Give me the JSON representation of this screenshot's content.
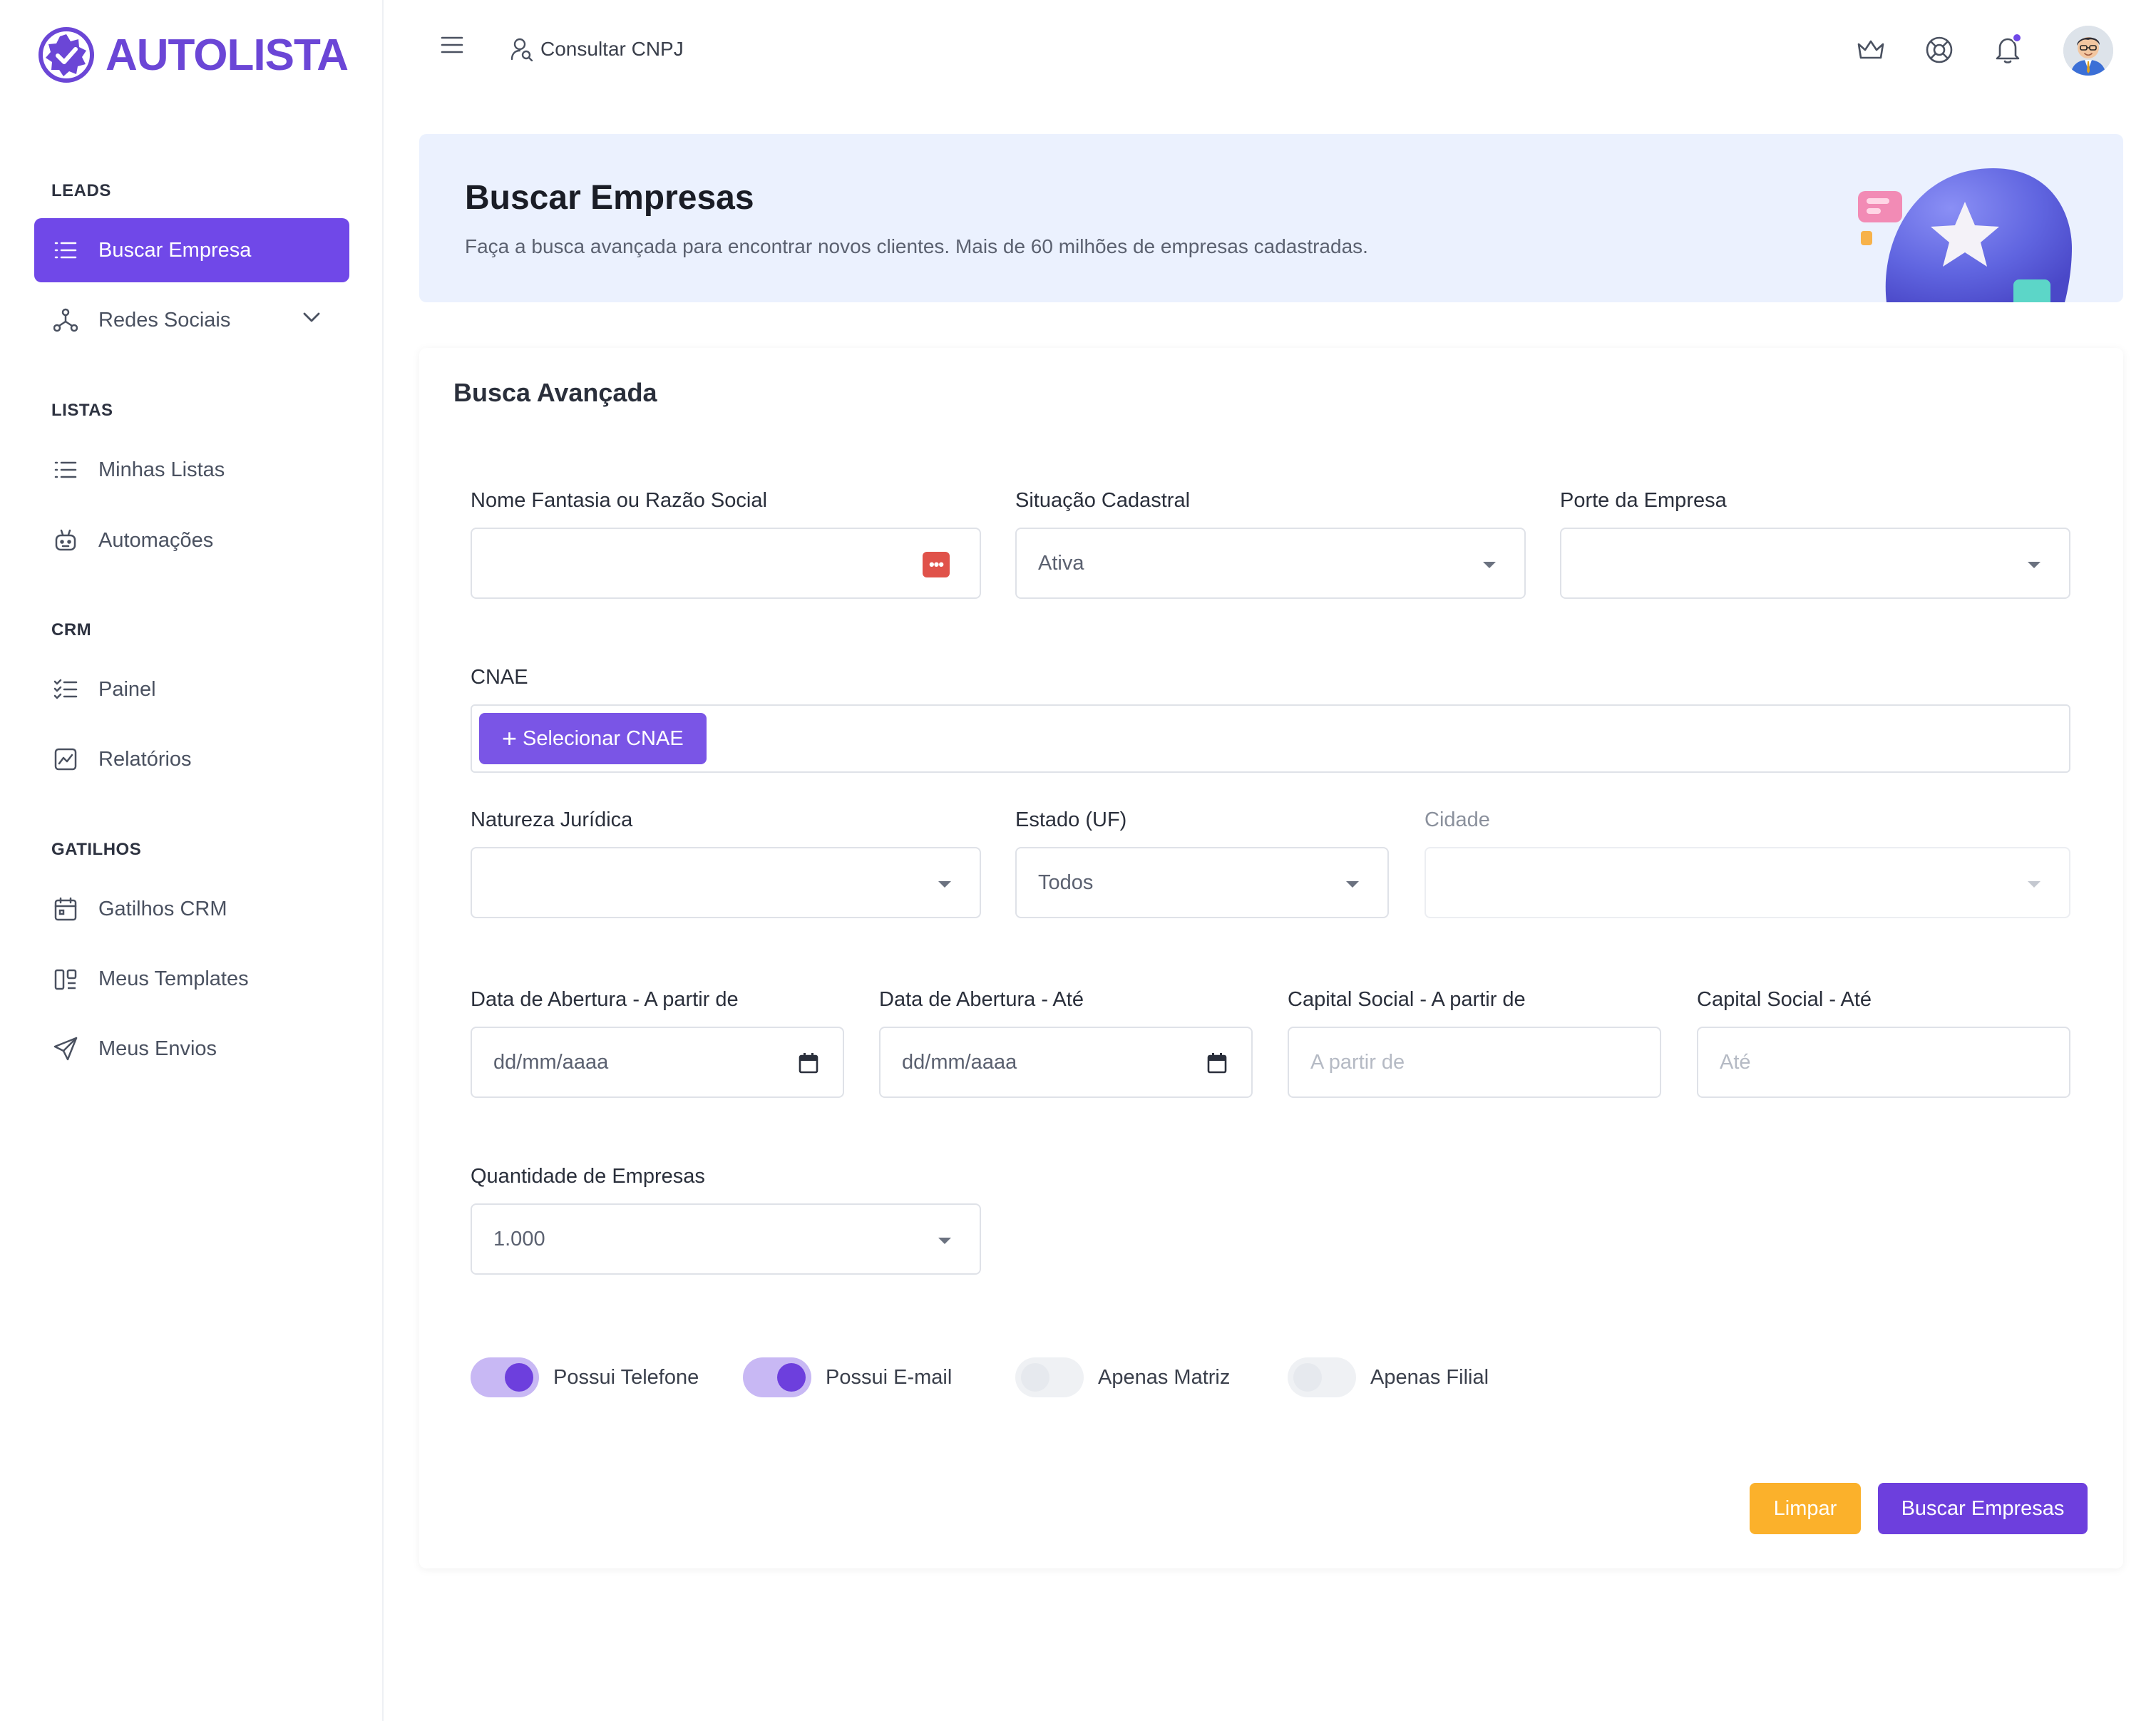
{
  "brand": {
    "name_light": "AUTO",
    "name_bold": "LISTA"
  },
  "sidebar": {
    "sections": [
      {
        "label": "LEADS"
      },
      {
        "label": "LISTAS"
      },
      {
        "label": "CRM"
      },
      {
        "label": "GATILHOS"
      }
    ],
    "items": [
      {
        "label": "Buscar Empresa",
        "icon": "list-icon",
        "active": true
      },
      {
        "label": "Redes Sociais",
        "icon": "network-icon",
        "has_chevron": true
      },
      {
        "label": "Minhas Listas",
        "icon": "list-icon"
      },
      {
        "label": "Automações",
        "icon": "robot-icon"
      },
      {
        "label": "Painel",
        "icon": "checklist-icon"
      },
      {
        "label": "Relatórios",
        "icon": "chart-icon"
      },
      {
        "label": "Gatilhos CRM",
        "icon": "calendar-icon"
      },
      {
        "label": "Meus Templates",
        "icon": "template-icon"
      },
      {
        "label": "Meus Envios",
        "icon": "send-icon"
      }
    ]
  },
  "topbar": {
    "cnpj_link": "Consultar CNPJ",
    "notification_dot": true
  },
  "banner": {
    "title": "Buscar Empresas",
    "subtitle": "Faça a busca avançada para encontrar novos clientes. Mais de 60 milhões de empresas cadastradas."
  },
  "form": {
    "title": "Busca Avançada",
    "nome": {
      "label": "Nome Fantasia ou Razão Social",
      "value": ""
    },
    "situacao": {
      "label": "Situação Cadastral",
      "value": "Ativa"
    },
    "porte": {
      "label": "Porte da Empresa",
      "value": ""
    },
    "cnae": {
      "label": "CNAE",
      "button": "Selecionar CNAE",
      "button_prefix": "+"
    },
    "natureza": {
      "label": "Natureza Jurídica",
      "value": ""
    },
    "estado": {
      "label": "Estado (UF)",
      "value": "Todos"
    },
    "cidade": {
      "label": "Cidade",
      "value": ""
    },
    "data_de": {
      "label": "Data de Abertura - A partir de",
      "placeholder": "dd/mm/aaaa"
    },
    "data_ate": {
      "label": "Data de Abertura - Até",
      "placeholder": "dd/mm/aaaa"
    },
    "capital_de": {
      "label": "Capital Social - A partir de",
      "placeholder": "A partir de"
    },
    "capital_ate": {
      "label": "Capital Social - Até",
      "placeholder": "Até"
    },
    "quantidade": {
      "label": "Quantidade de Empresas",
      "value": "1.000"
    },
    "toggles": [
      {
        "label": "Possui Telefone",
        "on": true
      },
      {
        "label": "Possui E-mail",
        "on": true
      },
      {
        "label": "Apenas Matriz",
        "on": false
      },
      {
        "label": "Apenas Filial",
        "on": false
      }
    ],
    "clear_button": "Limpar",
    "search_button": "Buscar Empresas"
  },
  "colors": {
    "accent": "#7048e8",
    "accent_dark": "#6d3fdd",
    "warning": "#fbb12b",
    "banner_bg": "#ebf1fe"
  }
}
